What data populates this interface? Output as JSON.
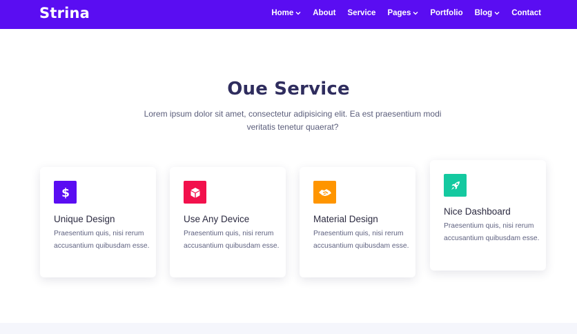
{
  "brand": {
    "logo": "Strina",
    "accent": "#5a0df2"
  },
  "nav": {
    "items": [
      {
        "label": "Home",
        "dropdown": true
      },
      {
        "label": "About",
        "dropdown": false
      },
      {
        "label": "Service",
        "dropdown": false
      },
      {
        "label": "Pages",
        "dropdown": true
      },
      {
        "label": "Portfolio",
        "dropdown": false
      },
      {
        "label": "Blog",
        "dropdown": true
      },
      {
        "label": "Contact",
        "dropdown": false
      }
    ]
  },
  "services": {
    "title": "Oue Service",
    "description": "Lorem ipsum dolor sit amet, consectetur adipisicing elit. Ea est praesentium modi veritatis tenetur quaerat?",
    "cards": [
      {
        "icon": "dollar-icon",
        "icon_color": "#5a0df2",
        "title": "Unique Design",
        "text": "Praesentium quis, nisi rerum accusantium quibusdam esse."
      },
      {
        "icon": "cube-icon",
        "icon_color": "#f2114c",
        "title": "Use Any Device",
        "text": "Praesentium quis, nisi rerum accusantium quibusdam esse."
      },
      {
        "icon": "handshake-icon",
        "icon_color": "#ff9500",
        "title": "Material Design",
        "text": "Praesentium quis, nisi rerum accusantium quibusdam esse."
      },
      {
        "icon": "rocket-icon",
        "icon_color": "#14c9a0",
        "title": "Nice Dashboard",
        "text": "Praesentium quis, nisi rerum accusantium quibusdam esse."
      }
    ]
  }
}
